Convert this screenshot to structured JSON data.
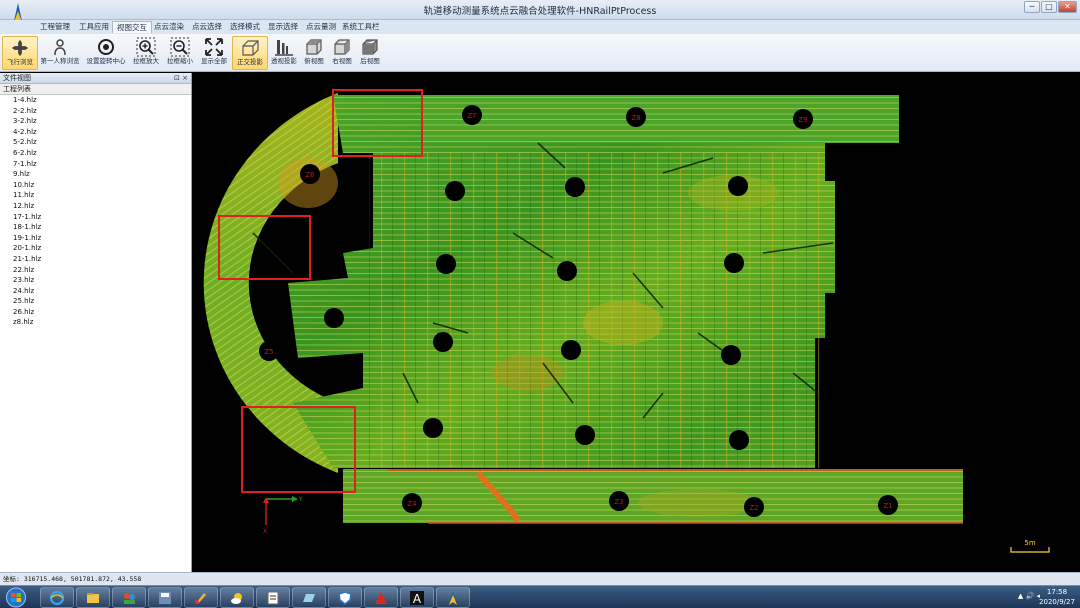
{
  "window": {
    "title": "轨道移动测量系统点云融合处理软件-HNRailPtProcess",
    "controls": [
      "─",
      "□",
      "✕"
    ]
  },
  "menu": [
    {
      "label": "工程管理",
      "active": false
    },
    {
      "label": "工具应用",
      "active": false
    },
    {
      "label": "视图交互",
      "active": true
    },
    {
      "label": "点云渲染",
      "active": false
    },
    {
      "label": "点云选择",
      "active": false
    },
    {
      "label": "选择模式",
      "active": false
    },
    {
      "label": "显示选择",
      "active": false
    },
    {
      "label": "点云量测",
      "active": false
    },
    {
      "label": "系统工具栏",
      "active": false
    }
  ],
  "toolbar": [
    {
      "label": "飞行浏览",
      "icon": "fly-icon",
      "highlighted": true
    },
    {
      "label": "第一人称浏览",
      "icon": "person-icon",
      "highlighted": false
    },
    {
      "label": "设置旋转中心",
      "icon": "rotation-center-icon",
      "highlighted": false
    },
    {
      "label": "拉框放大",
      "icon": "zoom-in-box-icon",
      "highlighted": false
    },
    {
      "label": "拉框缩小",
      "icon": "zoom-out-box-icon",
      "highlighted": false
    },
    {
      "label": "显示全部",
      "icon": "fit-all-icon",
      "highlighted": false
    },
    {
      "label": "正交投影",
      "icon": "ortho-projection-icon",
      "highlighted": true
    },
    {
      "label": "透视投影",
      "icon": "perspective-projection-icon",
      "highlighted": false
    },
    {
      "label": "俯视图",
      "icon": "top-view-icon",
      "highlighted": false
    },
    {
      "label": "右视图",
      "icon": "right-view-icon",
      "highlighted": false
    },
    {
      "label": "后视图",
      "icon": "back-view-icon",
      "highlighted": false
    }
  ],
  "file_panel": {
    "title": "文件视图",
    "controls": "⊡ ×",
    "list_header": "工程列表",
    "files": [
      "1-4.hlz",
      "2-2.hlz",
      "3-2.hlz",
      "4-2.hlz",
      "5-2.hlz",
      "6-2.hlz",
      "7-1.hlz",
      "9.hlz",
      "10.hlz",
      "11.hlz",
      "12.hlz",
      "17-1.hlz",
      "18-1.hlz",
      "19-1.hlz",
      "20-1.hlz",
      "21-1.hlz",
      "22.hlz",
      "23.hlz",
      "24.hlz",
      "25.hlz",
      "26.hlz",
      "z8.hlz"
    ]
  },
  "viewport": {
    "station_labels": [
      "Z1",
      "Z2",
      "Z3",
      "Z4",
      "Z5",
      "Z6",
      "Z7",
      "Z8",
      "Z9"
    ],
    "axis_y_label": "Y",
    "axis_x_label": "X",
    "scale_bar_label": "5m",
    "colors": {
      "background": "#000000",
      "cloud_green": "#3f9a1e",
      "cloud_yellow": "#c8c21a",
      "cloud_orange": "#d87a1c",
      "highlight_box": "#e02020",
      "station_marker": "#000000",
      "station_text": "#c01818"
    }
  },
  "status": {
    "coordinates": "坐标: 316715.468, 501781.872, 43.558"
  },
  "taskbar": {
    "apps": [
      "ie-icon",
      "explorer-icon",
      "users-icon",
      "save-icon",
      "paint-icon",
      "weather-icon",
      "document-icon",
      "folder-icon",
      "shield-icon",
      "acrobat-icon",
      "font-a-icon",
      "app-logo-icon"
    ],
    "tray": "▲ 🔊 ◂",
    "time": "17:58",
    "date": "2020/9/27"
  }
}
